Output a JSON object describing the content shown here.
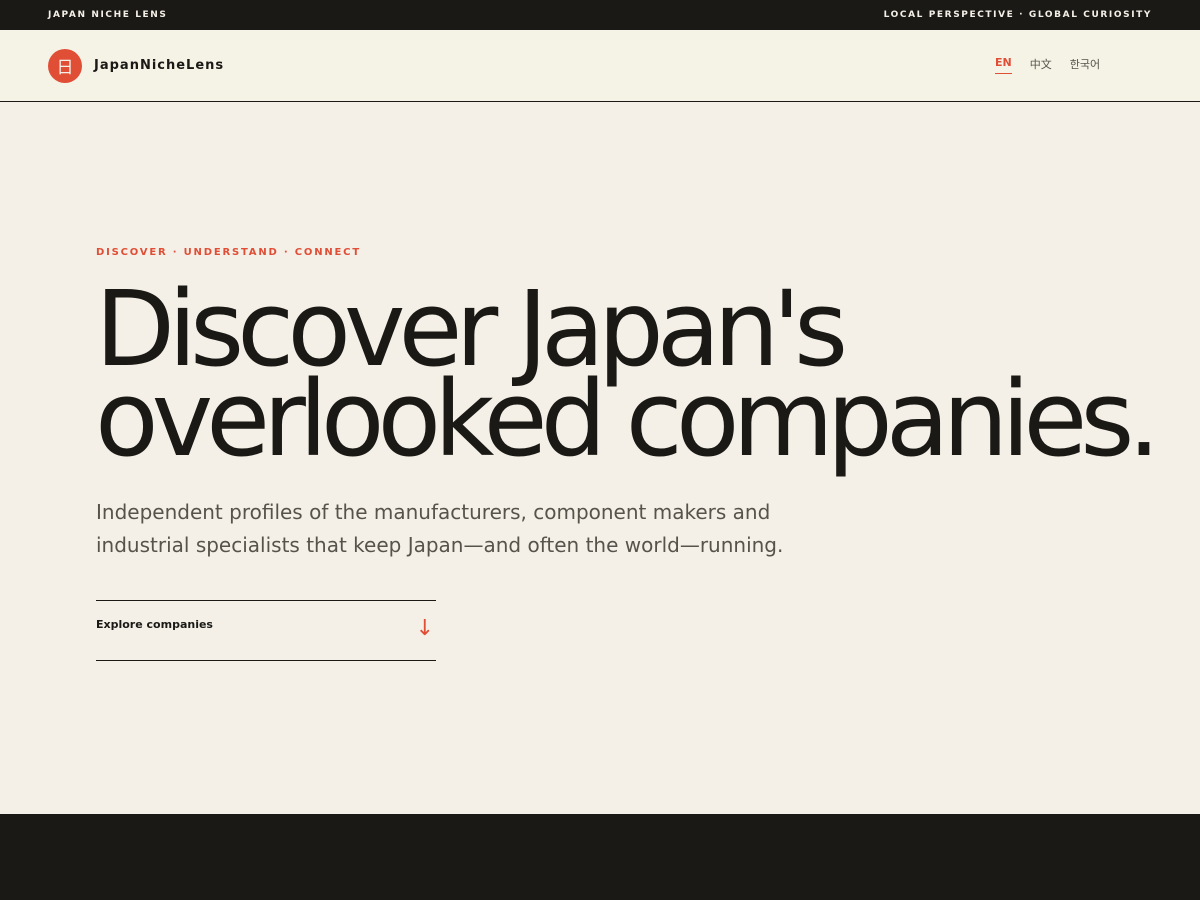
{
  "topbar": {
    "brand": "JAPAN NICHE LENS",
    "tagline": "LOCAL PERSPECTIVE · GLOBAL CURIOSITY"
  },
  "header": {
    "logo_glyph": "日",
    "logo_text": "JapanNicheLens",
    "languages": [
      {
        "label": "EN",
        "active": true
      },
      {
        "label": "中文",
        "active": false
      },
      {
        "label": "한국어",
        "active": false
      }
    ]
  },
  "hero": {
    "eyebrow": "DISCOVER · UNDERSTAND · CONNECT",
    "headline_line1": "Discover Japan's",
    "headline_line2": "overlooked companies.",
    "lede": "Independent profiles of the manufacturers, component makers and industrial specialists that keep Japan—and often the world—running.",
    "cta_label": "Explore companies",
    "cta_icon": "arrow-down-icon",
    "cta_arrow": "↓"
  },
  "colors": {
    "accent": "#e04e36",
    "ink": "#1a1915",
    "paper": "#f4f0e7"
  }
}
